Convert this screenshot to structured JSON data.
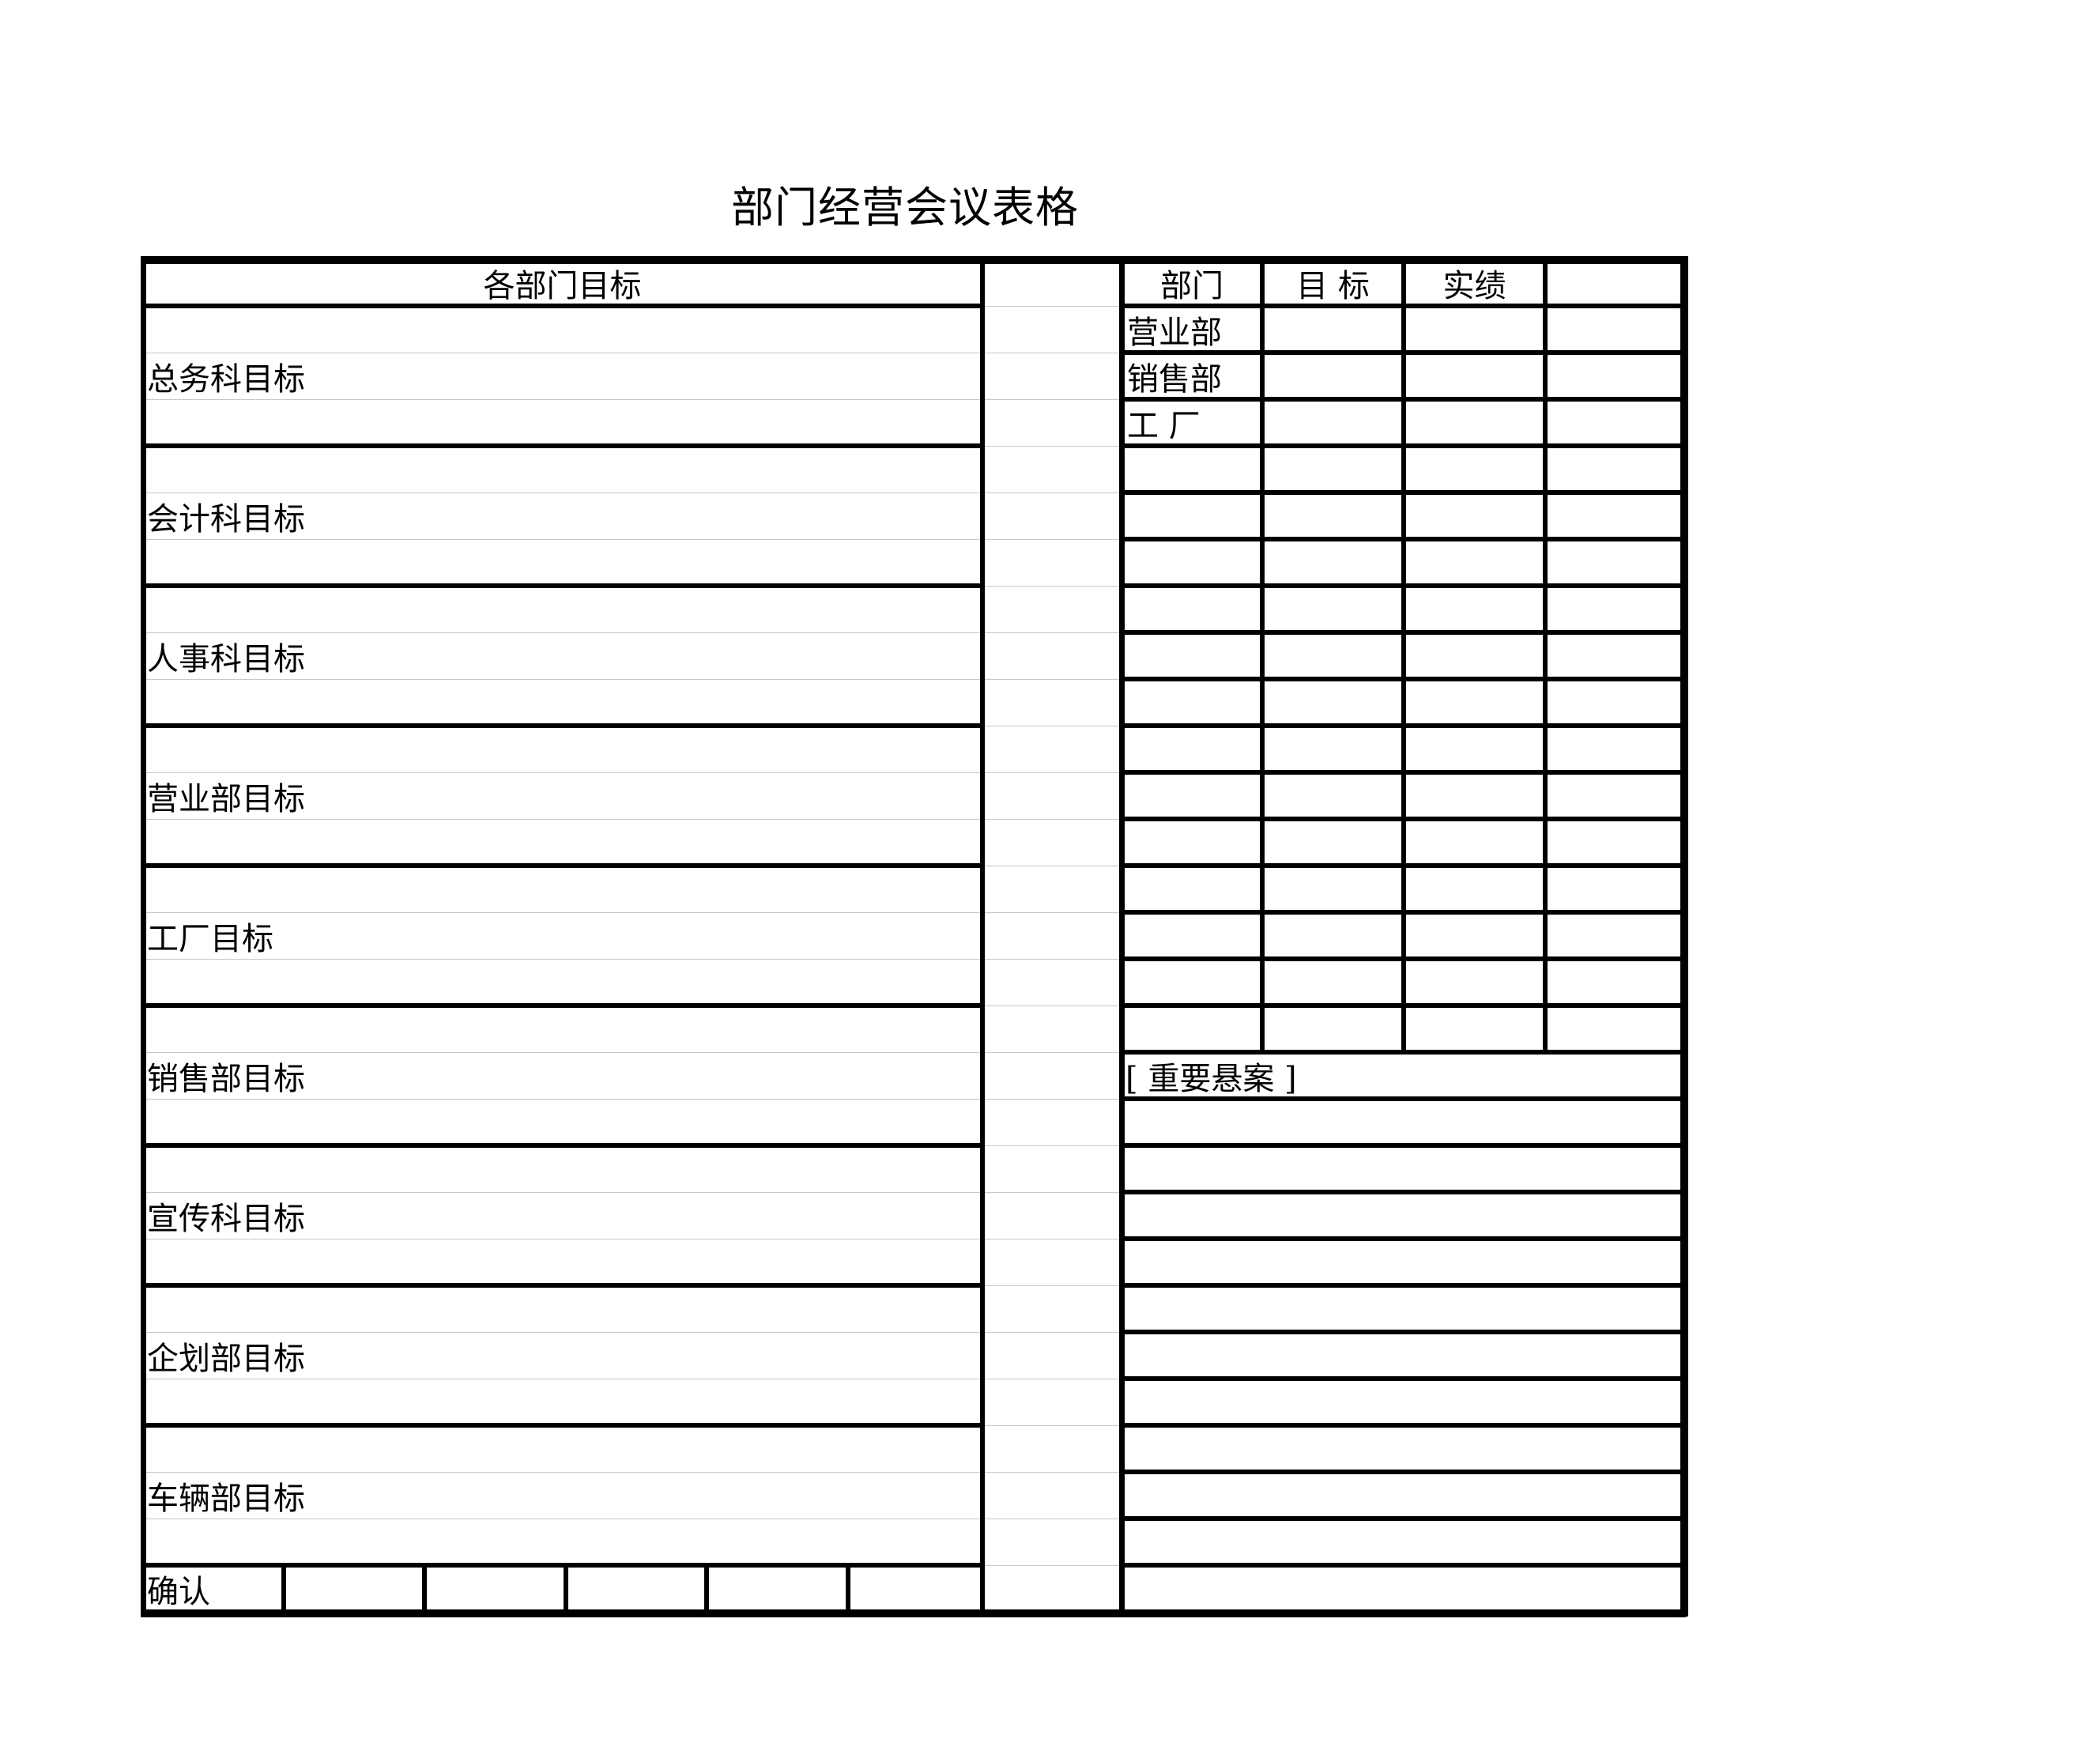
{
  "title": "部门经营会议表格",
  "left_block": {
    "header": "各部门目标",
    "sections": [
      {
        "label": "总务科目标",
        "content": ""
      },
      {
        "label": "会计科目标",
        "content": ""
      },
      {
        "label": "人事科目标",
        "content": ""
      },
      {
        "label": "营业部目标",
        "content": ""
      },
      {
        "label": "工厂目标",
        "content": ""
      },
      {
        "label": "销售部目标",
        "content": ""
      },
      {
        "label": "宣传科目标",
        "content": ""
      },
      {
        "label": "企划部目标",
        "content": ""
      },
      {
        "label": "车辆部目标",
        "content": ""
      }
    ],
    "confirm_label": "确认",
    "confirm_cells": [
      "",
      "",
      "",
      "",
      ""
    ]
  },
  "right_table": {
    "headers": [
      "部门",
      "目  标",
      "实绩",
      ""
    ],
    "rows": [
      [
        "营业部",
        "",
        "",
        ""
      ],
      [
        "销售部",
        "",
        "",
        ""
      ],
      [
        "工  厂",
        "",
        "",
        ""
      ],
      [
        "",
        "",
        "",
        ""
      ],
      [
        "",
        "",
        "",
        ""
      ],
      [
        "",
        "",
        "",
        ""
      ],
      [
        "",
        "",
        "",
        ""
      ],
      [
        "",
        "",
        "",
        ""
      ],
      [
        "",
        "",
        "",
        ""
      ],
      [
        "",
        "",
        "",
        ""
      ],
      [
        "",
        "",
        "",
        ""
      ],
      [
        "",
        "",
        "",
        ""
      ],
      [
        "",
        "",
        "",
        ""
      ],
      [
        "",
        "",
        "",
        ""
      ],
      [
        "",
        "",
        "",
        ""
      ],
      [
        "",
        "",
        "",
        ""
      ]
    ]
  },
  "pending_issues": {
    "label": "[ 重要悬案 ]",
    "lines": [
      "",
      "",
      "",
      "",
      "",
      "",
      "",
      "",
      "",
      "",
      ""
    ]
  }
}
